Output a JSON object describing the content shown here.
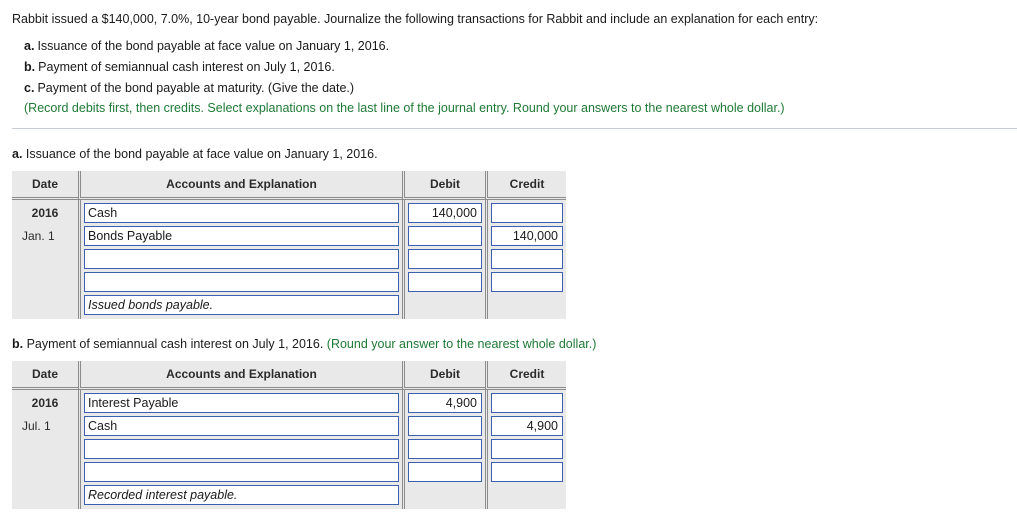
{
  "prompt": {
    "intro": "Rabbit issued a $140,000, 7.0%, 10-year bond payable. Journalize the following transactions for Rabbit and include an explanation for each entry:",
    "items": [
      {
        "marker": "a.",
        "text": "Issuance of the bond payable at face value on January 1, 2016."
      },
      {
        "marker": "b.",
        "text": "Payment of semiannual cash interest on July 1, 2016."
      },
      {
        "marker": "c.",
        "text": "Payment of the bond payable at maturity. (Give the date.)"
      }
    ],
    "note": "(Record debits first, then credits. Select explanations on the last line of the journal entry. Round your answers to the nearest whole dollar.)"
  },
  "table_headers": {
    "date": "Date",
    "accounts": "Accounts and Explanation",
    "debit": "Debit",
    "credit": "Credit"
  },
  "section_a": {
    "marker": "a.",
    "heading": "Issuance of the bond payable at face value on January 1, 2016.",
    "heading_green": "",
    "date_year": "2016",
    "date_day": "Jan. 1",
    "rows": [
      {
        "account": "Cash",
        "debit": "140,000",
        "credit": ""
      },
      {
        "account": "Bonds Payable",
        "debit": "",
        "credit": "140,000"
      },
      {
        "account": "",
        "debit": "",
        "credit": ""
      },
      {
        "account": "",
        "debit": "",
        "credit": ""
      }
    ],
    "explanation": "Issued bonds payable."
  },
  "section_b": {
    "marker": "b.",
    "heading": "Payment of semiannual cash interest on July 1, 2016.",
    "heading_green": "(Round your answer to the nearest whole dollar.)",
    "date_year": "2016",
    "date_day": "Jul. 1",
    "rows": [
      {
        "account": "Interest Payable",
        "debit": "4,900",
        "credit": ""
      },
      {
        "account": "Cash",
        "debit": "",
        "credit": "4,900"
      },
      {
        "account": "",
        "debit": "",
        "credit": ""
      },
      {
        "account": "",
        "debit": "",
        "credit": ""
      }
    ],
    "explanation": "Recorded interest payable."
  },
  "colors": {
    "green": "#1e7a35",
    "field_border": "#3c5fae",
    "table_bg": "#e9e9e9"
  }
}
